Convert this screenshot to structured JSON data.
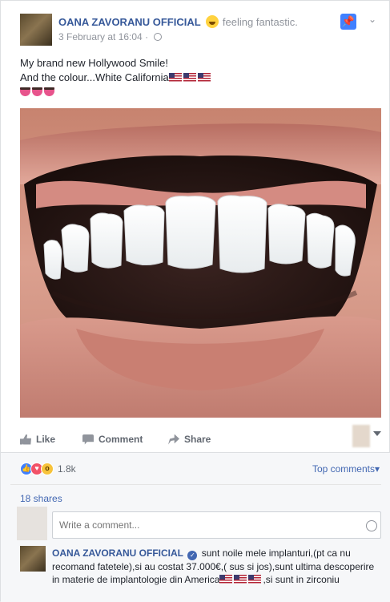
{
  "post": {
    "author": "OANA ZAVORANU OFFICIAL",
    "feeling": "feeling fantastic.",
    "timestamp": "3 February at 16:04",
    "line1": "My brand new Hollywood Smile!",
    "line2": "And the colour...White California",
    "photo_alt": "smile photo"
  },
  "actions": {
    "like": "Like",
    "comment": "Comment",
    "share": "Share"
  },
  "feedback": {
    "reaction_count": "1.8k",
    "top_comments": "Top comments",
    "shares": "18 shares",
    "composer_placeholder": "Write a comment..."
  },
  "comment": {
    "author": "OANA ZAVORANU OFFICIAL",
    "text1": "sunt noile mele implanturi,(pt ca nu recomand fatetele),si au costat 37.000€,( sus si jos),sunt ultima descoperire in materie de implantologie din America",
    "text2": ",si sunt in zirconiu"
  },
  "colors": {
    "link": "#365899",
    "accent": "#4080ff",
    "muted": "#90949c"
  },
  "icons": [
    "feeling-emoji-icon",
    "globe-icon",
    "pin-icon",
    "chevron-down-icon",
    "like-icon",
    "comment-icon",
    "share-icon",
    "us-flag-icon",
    "tongue-emoji-icon",
    "smiley-icon",
    "verified-icon"
  ]
}
